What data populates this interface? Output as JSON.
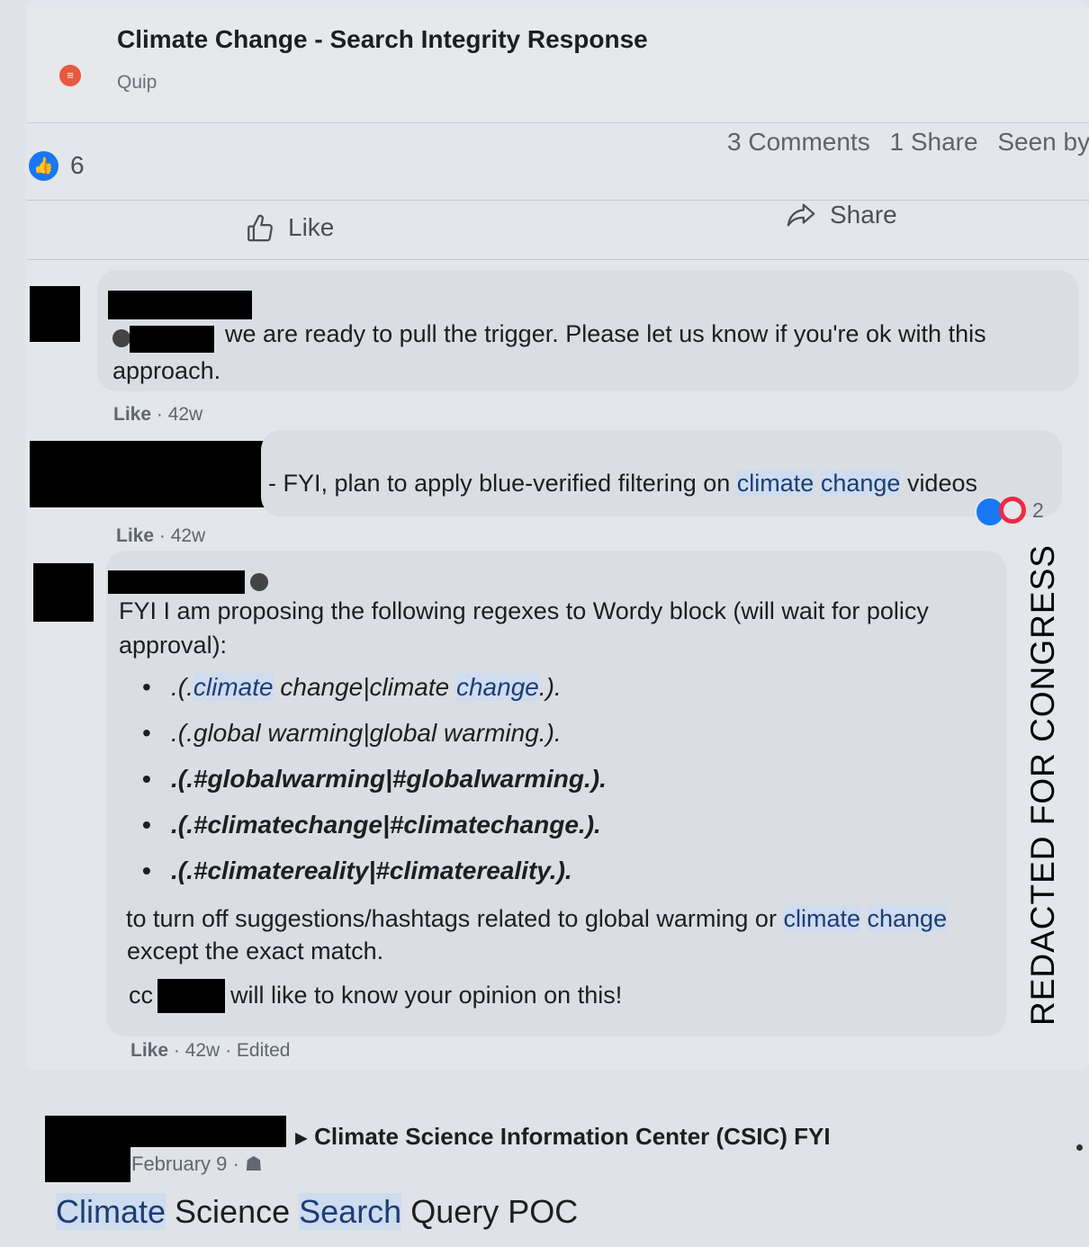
{
  "preview": {
    "title": "Climate Change - Search Integrity Response",
    "source": "Quip"
  },
  "stats": {
    "reaction_count": "6",
    "comments": "3 Comments",
    "shares": "1 Share",
    "seen_by": "Seen by"
  },
  "actions": {
    "like": "Like",
    "share": "Share"
  },
  "comments": [
    {
      "text_after_mention": "we are ready to pull the trigger. Please let us know if you're ok with this",
      "text_line2": "approach.",
      "like": "Like",
      "time": "42w"
    },
    {
      "text_prefix": "- FYI, plan to apply blue-verified filtering on",
      "hl1": "climate",
      "hl2": "change",
      "text_suffix": "videos",
      "reaction_count": "2",
      "like": "Like",
      "time": "42w"
    },
    {
      "intro_line1": "FYI I am proposing the following regexes to Wordy block (will wait for policy",
      "intro_line2": "approval):",
      "regexes": [
        {
          "pre": ".(.",
          "hl": "climate",
          "mid": " change|climate ",
          "hl2": "change",
          "post": ".)."
        },
        {
          "pre": ".(.global warming|global warming.).",
          "hl": "",
          "mid": "",
          "hl2": "",
          "post": ""
        },
        {
          "pre": ".(.#globalwarming|#globalwarming.).",
          "hl": "",
          "mid": "",
          "hl2": "",
          "post": ""
        },
        {
          "pre": ".(.#climatechange|#climatechange.).",
          "hl": "",
          "mid": "",
          "hl2": "",
          "post": ""
        },
        {
          "pre": ".(.#climatereality|#climatereality.).",
          "hl": "",
          "mid": "",
          "hl2": "",
          "post": ""
        }
      ],
      "outro_line1_pre": "to turn off suggestions/hashtags related to global warming or",
      "outro_hl1": "climate",
      "outro_hl2": "change",
      "outro_line2": "except the exact match.",
      "cc_prefix": "cc",
      "cc_suffix": "will like to know your opinion on this!",
      "like": "Like",
      "time": "42w",
      "edited": "Edited"
    }
  ],
  "next_post": {
    "group": "Climate Science Information Center (CSIC) FYI",
    "date": "February 9",
    "title_hl1": "Climate",
    "title_mid": "Science",
    "title_hl2": "Search",
    "title_rest": "Query POC"
  },
  "stamp": "REDACTED FOR CONGRESS"
}
